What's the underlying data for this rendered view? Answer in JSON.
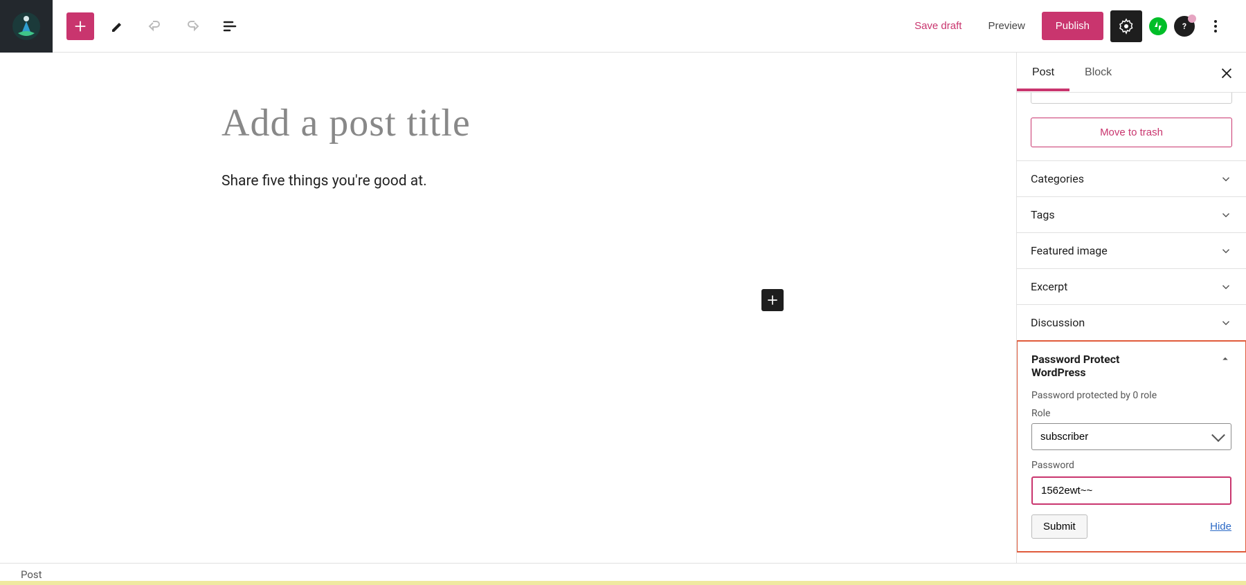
{
  "toolbar": {
    "save_draft": "Save draft",
    "preview": "Preview",
    "publish": "Publish"
  },
  "editor": {
    "title_placeholder": "Add a post title",
    "prompt": "Share five things you're good at."
  },
  "sidebar": {
    "tabs": {
      "post": "Post",
      "block": "Block"
    },
    "trash": "Move to trash",
    "panels": {
      "categories": "Categories",
      "tags": "Tags",
      "featured_image": "Featured image",
      "excerpt": "Excerpt",
      "discussion": "Discussion"
    },
    "ppw": {
      "title": "Password Protect WordPress",
      "status": "Password protected by 0 role",
      "role_label": "Role",
      "role_value": "subscriber",
      "password_label": "Password",
      "password_value": "1562ewt~~",
      "submit": "Submit",
      "hide": "Hide"
    }
  },
  "footer": {
    "breadcrumb": "Post"
  }
}
